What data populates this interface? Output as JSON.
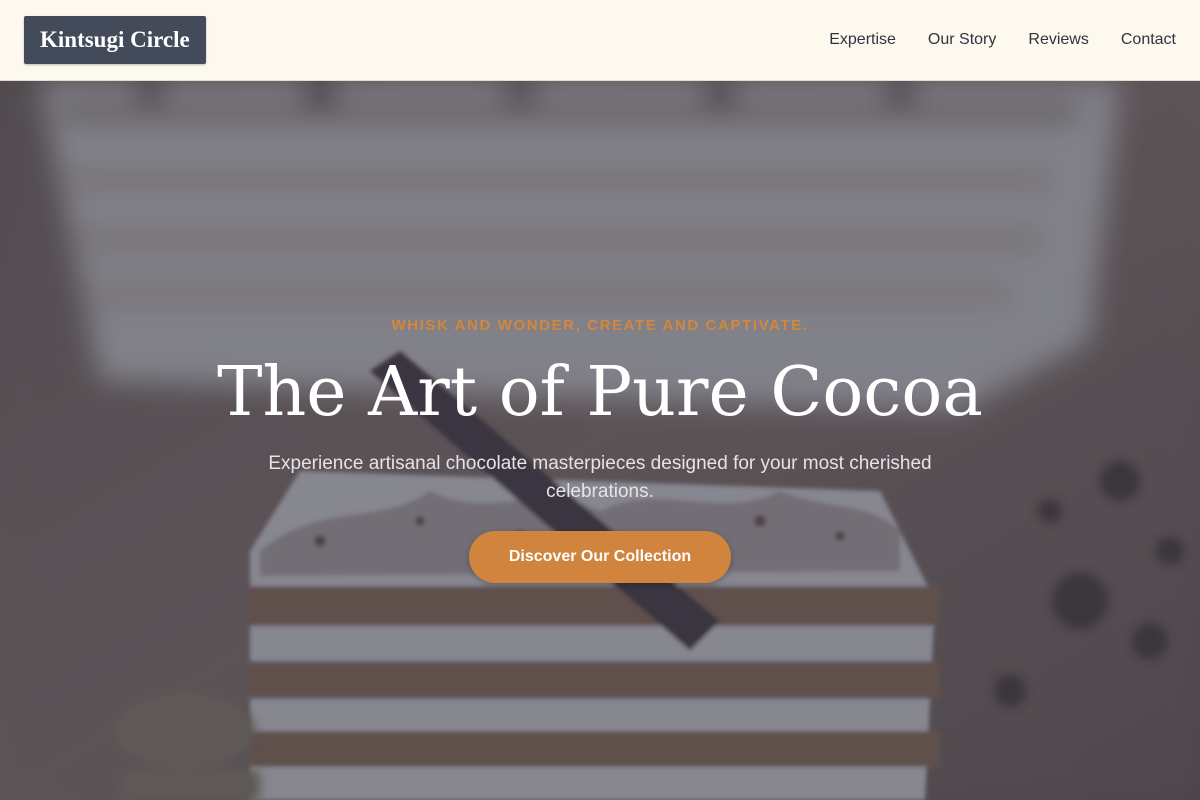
{
  "header": {
    "logo_text": "Kintsugi Circle",
    "nav": [
      {
        "label": "Expertise"
      },
      {
        "label": "Our Story"
      },
      {
        "label": "Reviews"
      },
      {
        "label": "Contact"
      }
    ]
  },
  "hero": {
    "eyebrow": "WHISK AND WONDER, CREATE AND CAPTIVATE.",
    "title": "The Art of Pure Cocoa",
    "subtitle": "Experience artisanal chocolate masterpieces designed for your most cherished celebrations.",
    "cta_label": "Discover Our Collection",
    "background_image": "blurred layered chocolate cake slice"
  },
  "colors": {
    "header_bg": "#fdf9ee",
    "logo_bg": "#434a5a",
    "accent": "#d0843d",
    "nav_text": "#2e3440",
    "hero_text": "#ffffff"
  }
}
